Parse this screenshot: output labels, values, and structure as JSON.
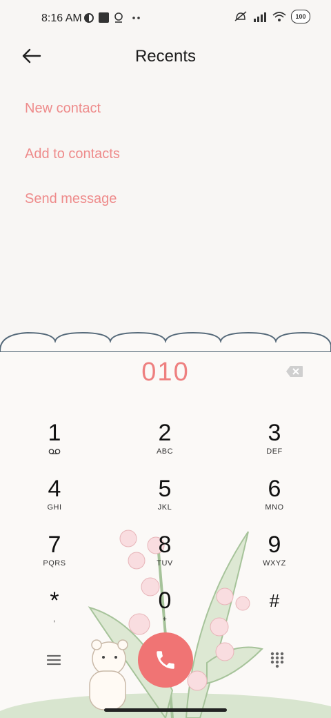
{
  "status_bar": {
    "time": "8:16 AM",
    "battery": "100"
  },
  "header": {
    "title": "Recents"
  },
  "actions": [
    {
      "label": "New contact"
    },
    {
      "label": "Add to contacts"
    },
    {
      "label": "Send message"
    }
  ],
  "dialer": {
    "number": "010",
    "keys": [
      {
        "digit": "1",
        "letters": ""
      },
      {
        "digit": "2",
        "letters": "ABC"
      },
      {
        "digit": "3",
        "letters": "DEF"
      },
      {
        "digit": "4",
        "letters": "GHI"
      },
      {
        "digit": "5",
        "letters": "JKL"
      },
      {
        "digit": "6",
        "letters": "MNO"
      },
      {
        "digit": "7",
        "letters": "PQRS"
      },
      {
        "digit": "8",
        "letters": "TUV"
      },
      {
        "digit": "9",
        "letters": "WXYZ"
      },
      {
        "digit": "*",
        "letters": ","
      },
      {
        "digit": "0",
        "letters": "+"
      },
      {
        "digit": "#",
        "letters": ""
      }
    ]
  },
  "icons": {
    "back": "back-arrow-icon",
    "backspace": "backspace-icon",
    "voicemail": "voicemail-icon",
    "menu": "menu-icon",
    "call": "phone-icon",
    "keypad": "keypad-icon"
  },
  "colors": {
    "accent": "#ee8b8b",
    "call": "#f07474",
    "background": "#f8f6f4"
  }
}
